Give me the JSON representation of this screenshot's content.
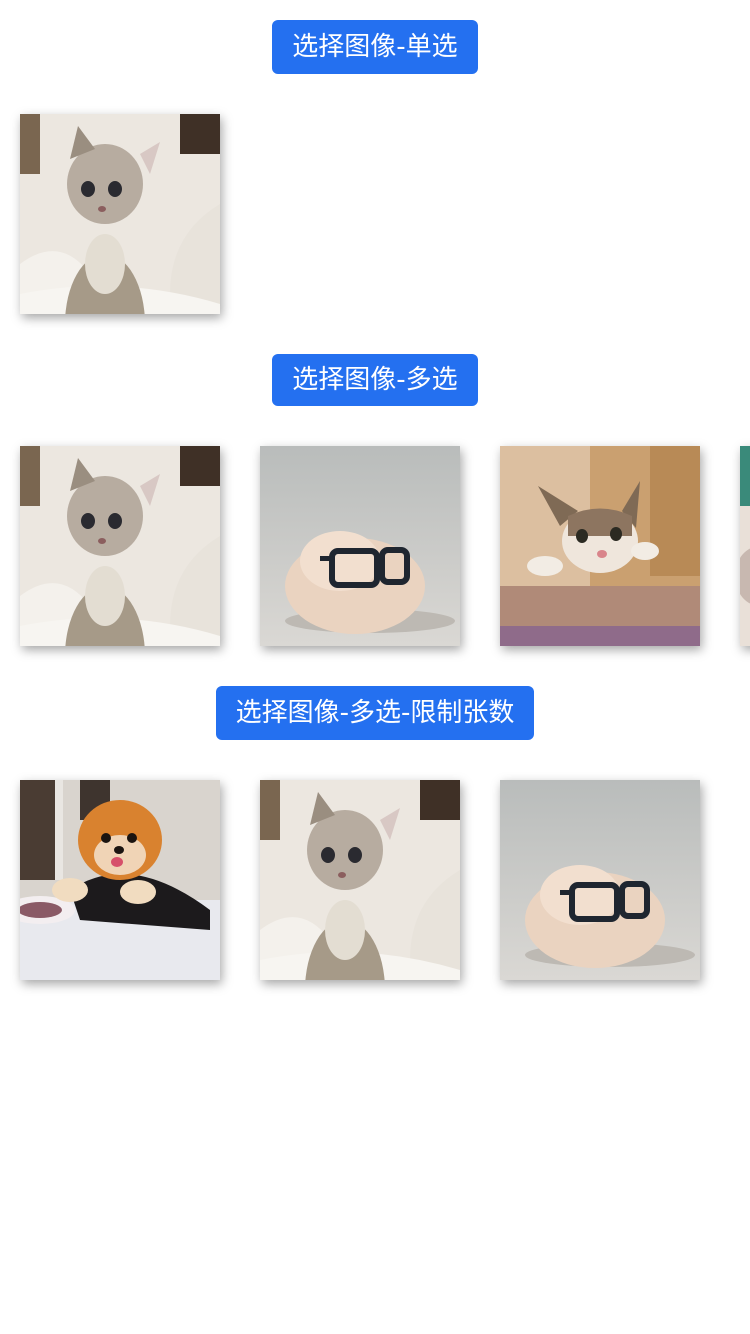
{
  "sections": [
    {
      "button_label": "选择图像-单选",
      "images": [
        "kitten-photo"
      ]
    },
    {
      "button_label": "选择图像-多选",
      "images": [
        "kitten-photo",
        "guinea-pig-glasses-photo",
        "cat-table-photo",
        "partial-photo"
      ]
    },
    {
      "button_label": "选择图像-多选-限制张数",
      "images": [
        "pomeranian-photo",
        "kitten-photo",
        "guinea-pig-glasses-photo"
      ]
    }
  ],
  "colors": {
    "accent": "#2470f0",
    "button_text": "#ffffff",
    "background": "#ffffff"
  }
}
